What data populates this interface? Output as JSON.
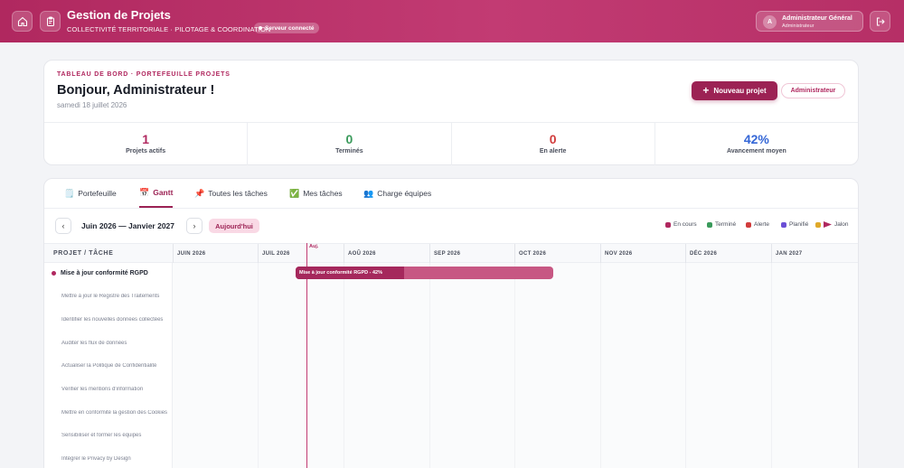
{
  "header": {
    "app_title": "Gestion de Projets",
    "subtitle": "COLLECTIVITÉ TERRITORIALE · PILOTAGE & COORDINATION",
    "server_status": "Serveur connecté",
    "user_initial": "A",
    "user_name": "Administrateur Général",
    "user_role": "Administrateur"
  },
  "dashboard": {
    "eyebrow": "TABLEAU DE BORD · PORTEFEUILLE PROJETS",
    "greeting": "Bonjour, Administrateur !",
    "date": "samedi 18 juillet 2026",
    "new_project_label": "Nouveau projet",
    "role_pill": "Administrateur",
    "stats": [
      {
        "value": "1",
        "label": "Projets actifs",
        "color": "#b0285f"
      },
      {
        "value": "0",
        "label": "Terminés",
        "color": "#3a9a5b"
      },
      {
        "value": "0",
        "label": "En alerte",
        "color": "#d13c3c"
      },
      {
        "value": "42%",
        "label": "Avancement moyen",
        "color": "#3466d6"
      }
    ]
  },
  "tabs": [
    {
      "icon": "🗒️",
      "label": "Portefeuille"
    },
    {
      "icon": "📅",
      "label": "Gantt"
    },
    {
      "icon": "📌",
      "label": "Toutes les tâches"
    },
    {
      "icon": "✅",
      "label": "Mes tâches"
    },
    {
      "icon": "👥",
      "label": "Charge équipes"
    }
  ],
  "gantt": {
    "period": "Juin 2026 — Janvier 2027",
    "today_label": "Aujourd'hui",
    "today_marker": "Auj.",
    "legend": [
      {
        "label": "En cours",
        "color": "#b0285f"
      },
      {
        "label": "Terminé",
        "color": "#3a9a5b"
      },
      {
        "label": "Alerte",
        "color": "#d13c3c"
      },
      {
        "label": "Planifié",
        "color": "#6b4fd6"
      },
      {
        "label": "Jalon",
        "color": "#e0a92a"
      }
    ],
    "column_title": "PROJET / TÂCHE",
    "months": [
      "JUIN 2026",
      "JUIL 2026",
      "AOÛ 2026",
      "SEP 2026",
      "OCT 2026",
      "NOV 2026",
      "DÉC 2026",
      "JAN 2027"
    ],
    "project": {
      "name": "Mise à jour conformité RGPD",
      "bar_label": "Mise à jour conformité RGPD - 42%",
      "progress": 0.42
    },
    "tasks": [
      "Mettre à jour le Registre des Traitements",
      "Identifier les nouvelles données collectées",
      "Auditer les flux de données",
      "Actualiser la Politique de Confidentialité",
      "Vérifier les mentions d'information",
      "Mettre en conformité la gestion des Cookies",
      "Sensibiliser et former les équipes",
      "Intégrer le Privacy by Design"
    ]
  }
}
